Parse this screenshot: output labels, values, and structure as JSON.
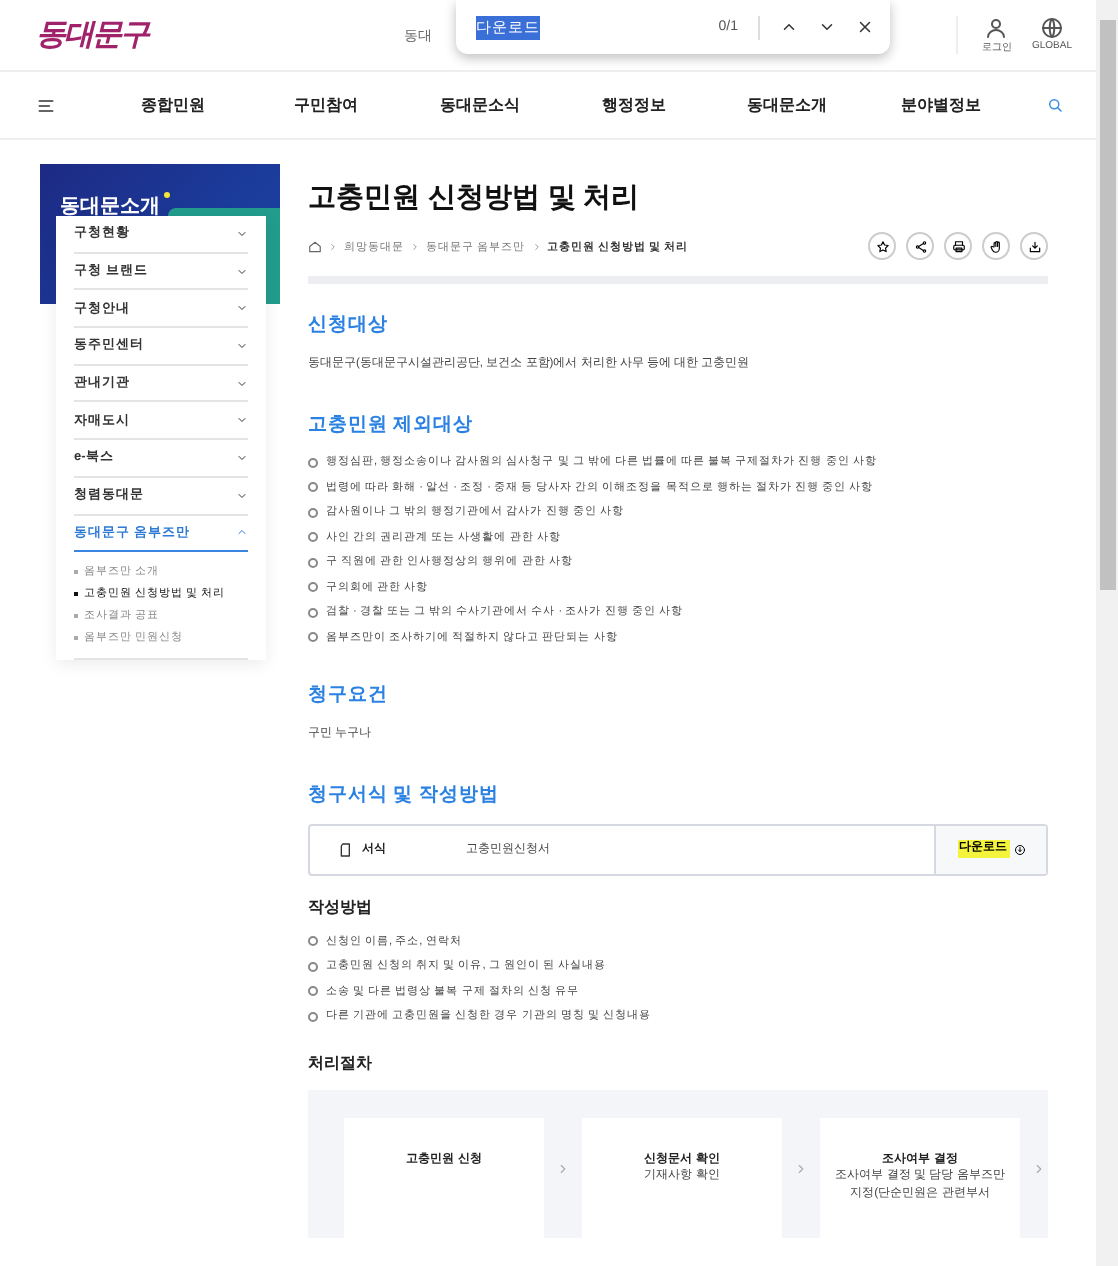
{
  "header": {
    "logo": "동대문구",
    "search_text": "동대",
    "login": "로그인",
    "global": "GLOBAL"
  },
  "find_bar": {
    "query": "다운로드",
    "count": "0/1"
  },
  "nav": {
    "items": [
      "종합민원",
      "구민참여",
      "동대문소식",
      "행정정보",
      "동대문소개",
      "분야별정보"
    ]
  },
  "sidebar": {
    "title": "동대문소개",
    "items": [
      {
        "label": "구청현황",
        "expanded": false
      },
      {
        "label": "구청 브랜드",
        "expanded": false
      },
      {
        "label": "구청안내",
        "expanded": false
      },
      {
        "label": "동주민센터",
        "expanded": false
      },
      {
        "label": "관내기관",
        "expanded": false
      },
      {
        "label": "자매도시",
        "expanded": false
      },
      {
        "label": "e-북스",
        "expanded": false
      },
      {
        "label": "청렴동대문",
        "expanded": false
      },
      {
        "label": "동대문구 옴부즈만",
        "expanded": true,
        "children": [
          {
            "label": "옴부즈만 소개",
            "selected": false
          },
          {
            "label": "고충민원 신청방법 및 처리",
            "selected": true
          },
          {
            "label": "조사결과 공표",
            "selected": false
          },
          {
            "label": "옴부즈만 민원신청",
            "selected": false
          }
        ]
      }
    ]
  },
  "page": {
    "title": "고충민원 신청방법 및 처리",
    "breadcrumb": [
      "희망동대문",
      "동대문구 옴부즈만",
      "고충민원 신청방법 및 처리"
    ]
  },
  "sections": [
    {
      "heading": "신청대상",
      "kind": "text",
      "text": "동대문구(동대문구시설관리공단, 보건소 포함)에서 처리한 사무 등에 대한 고충민원"
    },
    {
      "heading": "고충민원 제외대상",
      "kind": "list",
      "items": [
        "행정심판, 행정소송이나 감사원의 심사청구 및 그 밖에 다른 법률에 따른 불복 구제절차가 진행 중인 사항",
        "법령에 따라 화해 · 알선 · 조정 · 중재 등 당사자 간의 이해조정을 목적으로 행하는 절차가 진행 중인 사항",
        "감사원이나 그 밖의 행정기관에서 감사가 진행 중인 사항",
        "사인 간의 권리관계 또는 사생활에 관한 사항",
        "구 직원에 관한 인사행정상의 행위에 관한 사항",
        "구의회에 관한 사항",
        "검찰 · 경찰 또는 그 밖의 수사기관에서 수사 · 조사가 진행 중인 사항",
        "옴부즈만이 조사하기에 적절하지 않다고 판단되는 사항"
      ]
    },
    {
      "heading": "청구요건",
      "kind": "text",
      "text": "구민 누구나"
    },
    {
      "heading": "청구서식 및 작성방법",
      "kind": "form",
      "form_label": "서식",
      "form_name": "고충민원신청서",
      "download": "다운로드",
      "subheading": "작성방법",
      "items": [
        "신청인 이름, 주소, 연락처",
        "고충민원 신청의 취지 및 이유, 그 원인이 된 사실내용",
        "소송 및 다른 법령상 불복 구제 절차의 신청 유무",
        "다른 기관에 고충민원을 신청한 경우 기관의 명칭 및 신청내용"
      ]
    }
  ],
  "process": {
    "heading": "처리절차",
    "steps": [
      {
        "title": "고충민원 신청"
      },
      {
        "title": "신청문서 확인",
        "text": "기재사항 확인"
      },
      {
        "title": "조사여부 결정",
        "text": "조사여부 결정 및 담당 옴부즈만 지정(단순민원은 관련부서"
      }
    ]
  }
}
